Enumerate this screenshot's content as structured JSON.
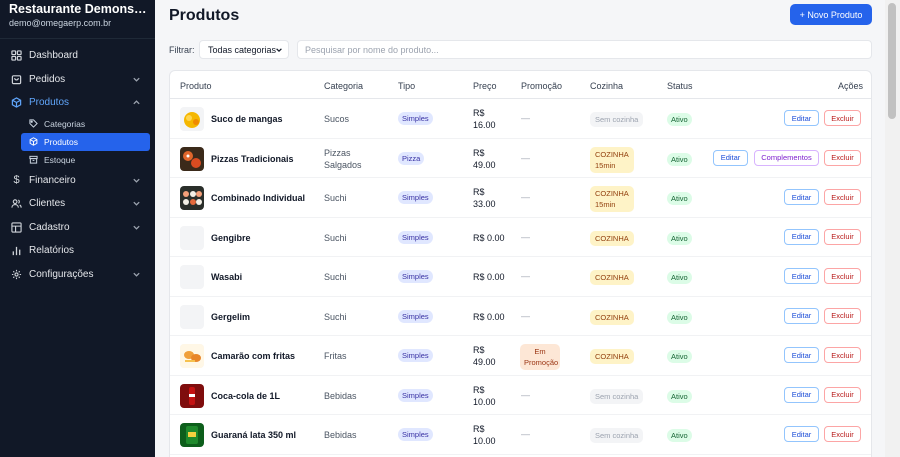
{
  "sidebar": {
    "brand_name": "Restaurante Demonstração",
    "brand_email": "demo@omegaerp.com.br",
    "items": [
      {
        "label": "Dashboard",
        "icon": "grid-icon"
      },
      {
        "label": "Pedidos",
        "icon": "cart-icon"
      },
      {
        "label": "Produtos",
        "icon": "box-icon"
      },
      {
        "label": "Financeiro",
        "icon": "dollar-icon"
      },
      {
        "label": "Clientes",
        "icon": "users-icon"
      },
      {
        "label": "Cadastro",
        "icon": "table-icon"
      },
      {
        "label": "Relatórios",
        "icon": "bar-chart-icon"
      },
      {
        "label": "Configurações",
        "icon": "gear-icon"
      }
    ],
    "sub_items": [
      {
        "label": "Categorias",
        "icon": "tags-icon"
      },
      {
        "label": "Produtos",
        "icon": "box-icon"
      },
      {
        "label": "Estoque",
        "icon": "archive-icon"
      }
    ]
  },
  "header": {
    "title": "Produtos",
    "new_button": "+ Novo Produto"
  },
  "filter": {
    "label": "Filtrar:",
    "category_value": "Todas categorias",
    "search_placeholder": "Pesquisar por nome do produto..."
  },
  "table": {
    "columns": [
      "Produto",
      "Categoria",
      "Tipo",
      "Preço",
      "Promoção",
      "Cozinha",
      "Status",
      "Ações"
    ],
    "edit_label": "Editar",
    "delete_label": "Excluir",
    "complements_label": "Complementos",
    "rows": [
      {
        "name": "Suco de mangas",
        "category": [
          "Sucos"
        ],
        "type": "Simples",
        "price": [
          "R$",
          "16.00"
        ],
        "promo": "—",
        "kitchen": [
          "Sem cozinha"
        ],
        "status": "Ativo"
      },
      {
        "name": "Pizzas Tradicionais",
        "category": [
          "Pizzas",
          "Salgados"
        ],
        "type": "Pizza",
        "price": [
          "R$",
          "49.00"
        ],
        "promo": "—",
        "kitchen": [
          "COZINHA",
          "15min"
        ],
        "status": "Ativo"
      },
      {
        "name": "Combinado Individual",
        "category": [
          "Suchi"
        ],
        "type": "Simples",
        "price": [
          "R$",
          "33.00"
        ],
        "promo": "—",
        "kitchen": [
          "COZINHA",
          "15min"
        ],
        "status": "Ativo"
      },
      {
        "name": "Gengibre",
        "category": [
          "Suchi"
        ],
        "type": "Simples",
        "price": [
          "R$ 0.00"
        ],
        "promo": "—",
        "kitchen": [
          "COZINHA"
        ],
        "status": "Ativo"
      },
      {
        "name": "Wasabi",
        "category": [
          "Suchi"
        ],
        "type": "Simples",
        "price": [
          "R$ 0.00"
        ],
        "promo": "—",
        "kitchen": [
          "COZINHA"
        ],
        "status": "Ativo"
      },
      {
        "name": "Gergelim",
        "category": [
          "Suchi"
        ],
        "type": "Simples",
        "price": [
          "R$ 0.00"
        ],
        "promo": "—",
        "kitchen": [
          "COZINHA"
        ],
        "status": "Ativo"
      },
      {
        "name": "Camarão com fritas",
        "category": [
          "Fritas"
        ],
        "type": "Simples",
        "price": [
          "R$",
          "49.00"
        ],
        "promo": "Em Promoção",
        "kitchen": [
          "COZINHA"
        ],
        "status": "Ativo"
      },
      {
        "name": "Coca-cola de 1L",
        "category": [
          "Bebidas"
        ],
        "type": "Simples",
        "price": [
          "R$",
          "10.00"
        ],
        "promo": "—",
        "kitchen": [
          "Sem cozinha"
        ],
        "status": "Ativo"
      },
      {
        "name": "Guaraná lata 350 ml",
        "category": [
          "Bebidas"
        ],
        "type": "Simples",
        "price": [
          "R$",
          "10.00"
        ],
        "promo": "—",
        "kitchen": [
          "Sem cozinha"
        ],
        "status": "Ativo"
      }
    ]
  }
}
